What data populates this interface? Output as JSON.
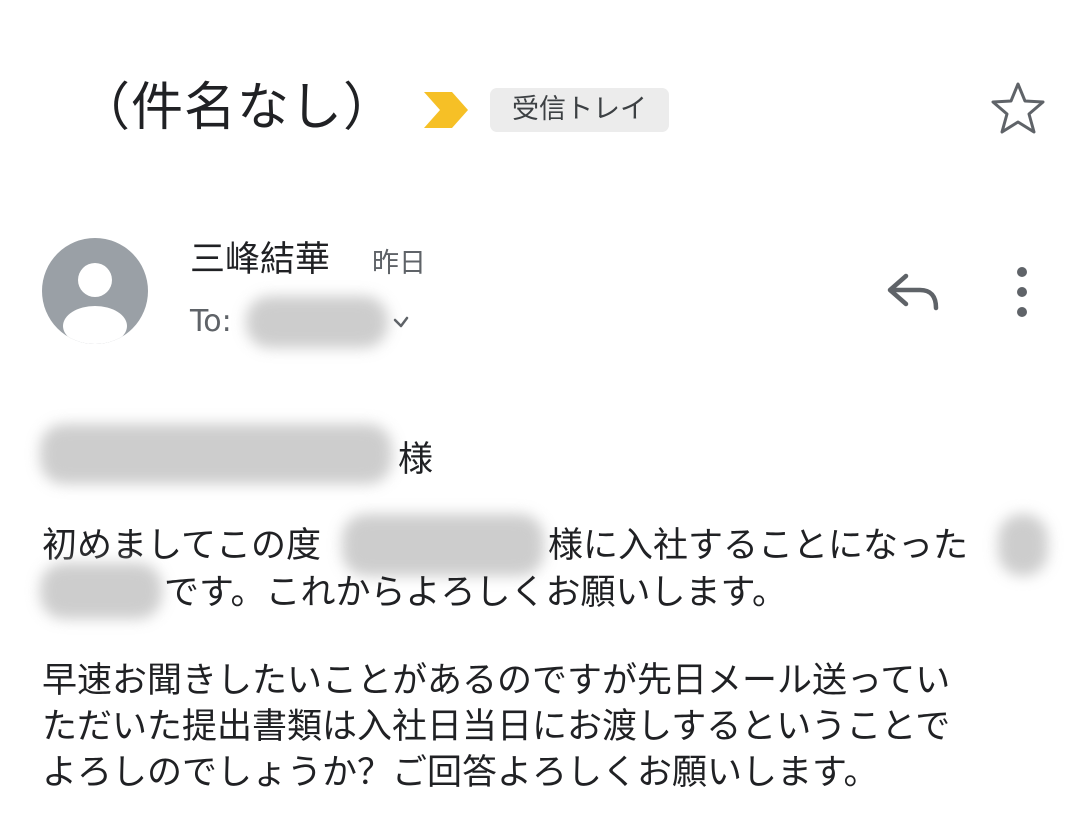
{
  "header": {
    "subject": "（件名なし）",
    "label_chip": "受信トレイ",
    "importance_color": "#f6c026"
  },
  "message": {
    "sender_name": "三峰結華",
    "date": "昨日",
    "to_label": "To:",
    "avatar_color": "#9aa0a6"
  },
  "body": {
    "salutation_suffix": "様",
    "p1_line1_start": "初めましてこの度",
    "p1_line1_mid": "様に入社することになった",
    "p1_line2_end": "です。これからよろしくお願いします。",
    "p2_line1": "早速お聞きしたいことがあるのですが先日メール送ってい",
    "p2_line2": "ただいた提出書類は入社日当日にお渡しするということで",
    "p2_line3": "よろしのでしょうか？ご回答よろしくお願いします。"
  },
  "icons": {
    "importance": "importance-marker-icon",
    "star": "star-icon",
    "avatar": "person-icon",
    "reply": "reply-icon",
    "more": "more-vert-icon",
    "recipient_details": "chevron-down-icon"
  }
}
